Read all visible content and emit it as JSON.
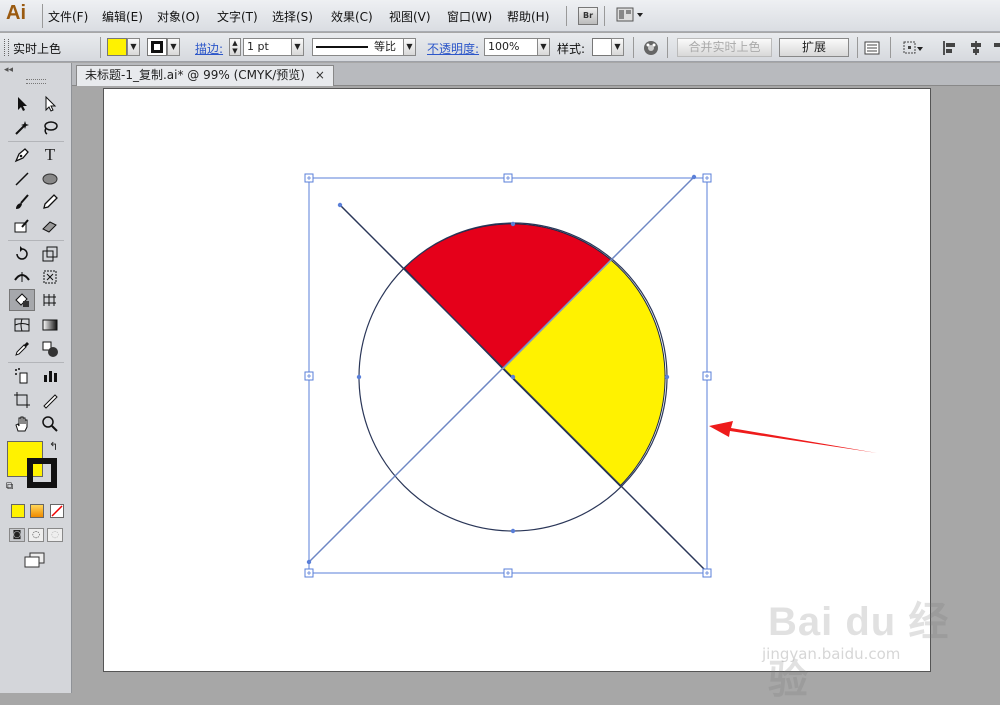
{
  "app": {
    "logo": "Ai"
  },
  "menubar": {
    "items": [
      {
        "label": "文件(F)"
      },
      {
        "label": "编辑(E)"
      },
      {
        "label": "对象(O)"
      },
      {
        "label": "文字(T)"
      },
      {
        "label": "选择(S)"
      },
      {
        "label": "效果(C)"
      },
      {
        "label": "视图(V)"
      },
      {
        "label": "窗口(W)"
      },
      {
        "label": "帮助(H)"
      }
    ],
    "bridge_label": "Br"
  },
  "controlbar": {
    "mode_label": "实时上色",
    "stroke_label": "描边:",
    "stroke_weight": "1 pt",
    "stroke_profile": "等比",
    "opacity_label": "不透明度:",
    "opacity_value": "100%",
    "style_label": "样式:",
    "merge_button": "合并实时上色",
    "expand_button": "扩展",
    "fill_color": "#fff200"
  },
  "document": {
    "tab_title": "未标题-1_复制.ai* @ 99% (CMYK/预览)",
    "close_glyph": "×"
  },
  "toolpanel": {
    "collapse_glyph": "◂◂",
    "fill_color": "#fff200",
    "stroke_color": "#111111",
    "mode_colors": [
      "#fff200",
      "#f7a21b",
      "none"
    ]
  },
  "artwork": {
    "segment_colors": {
      "top": "#e5001a",
      "right": "#fff200"
    },
    "arrow_color": "#ee1b1b",
    "selection_color": "#5a7fd8"
  },
  "watermark": {
    "logo": "Bai du 经验",
    "url": "jingyan.baidu.com"
  }
}
